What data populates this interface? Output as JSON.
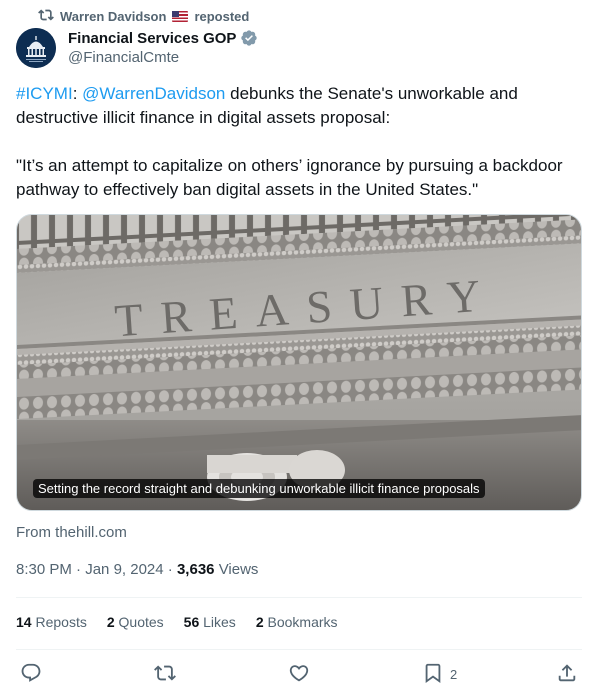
{
  "repost": {
    "user": "Warren Davidson",
    "label": "reposted"
  },
  "author": {
    "name": "Financial Services GOP",
    "handle": "@FinancialCmte"
  },
  "tweet": {
    "hashtag": "#ICYMI",
    "colon": ":",
    "mention": "@WarrenDavidson",
    "text1": " debunks the Senate's unworkable and destructive illicit finance in digital assets proposal:",
    "quote": "\"It’s an attempt to capitalize on others’ ignorance by pursuing a backdoor pathway to effectively ban digital assets in the United States.\""
  },
  "media": {
    "image_text": "TREASURY",
    "caption": "Setting the record straight and debunking unworkable illicit finance proposals"
  },
  "source": {
    "prefix": "From ",
    "domain": "thehill.com"
  },
  "meta": {
    "time": "8:30 PM",
    "date": "Jan 9, 2024",
    "views_count": "3,636",
    "views_label": "Views"
  },
  "stats": {
    "reposts_count": "14",
    "reposts_label": "Reposts",
    "quotes_count": "2",
    "quotes_label": "Quotes",
    "likes_count": "56",
    "likes_label": "Likes",
    "bookmarks_count": "2",
    "bookmarks_label": "Bookmarks"
  },
  "actions": {
    "bookmark_count": "2"
  },
  "icons": {
    "repost": "repost-icon",
    "verified": "verified-badge-icon",
    "flag": "us-flag-icon",
    "reply": "reply-icon",
    "retweet": "retweet-icon",
    "like": "heart-icon",
    "bookmark": "bookmark-icon",
    "share": "share-icon"
  },
  "colors": {
    "link": "#1d9bf0",
    "secondary_text": "#536471",
    "verified": "#829aab"
  }
}
